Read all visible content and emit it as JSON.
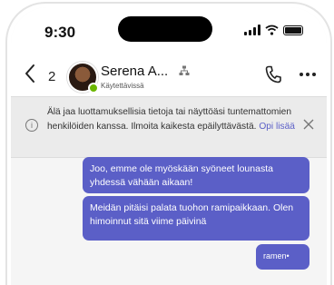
{
  "status_bar": {
    "time": "9:30"
  },
  "header": {
    "unread_count": "2",
    "contact_name": "Serena A...",
    "contact_status": "Käytettävissä"
  },
  "banner": {
    "text": "Älä jaa luottamuksellisia tietoja tai näyttöäsi tuntemattomien henkilöiden kanssa. Ilmoita kaikesta epäilyttävästä.",
    "link": "Opi lisää"
  },
  "messages": [
    {
      "text": "Joo, emme ole myöskään syöneet lounasta yhdessä vähään aikaan!"
    },
    {
      "text": "Meidän pitäisi palata tuohon ramipaikkaan. Olen himoinnut sitä viime päivinä"
    },
    {
      "text": "ramen•"
    }
  ],
  "colors": {
    "accent": "#5b5fc7",
    "banner_bg": "#ebebeb",
    "chat_bg": "#f5f5f5",
    "presence": "#6bb700"
  },
  "icons": [
    "back-chevron-icon",
    "org-chart-icon",
    "phone-call-icon",
    "more-options-icon",
    "info-icon",
    "close-icon",
    "signal-icon",
    "wifi-icon",
    "battery-icon"
  ]
}
